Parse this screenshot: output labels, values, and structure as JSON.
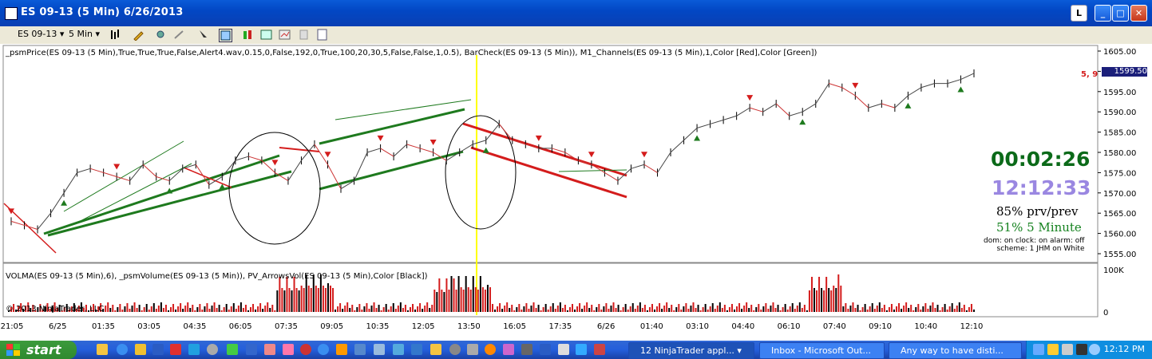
{
  "window": {
    "title": "ES 09-13 (5 Min)  6/26/2013",
    "buttons": [
      "L",
      "_",
      "□",
      "✕"
    ]
  },
  "toolbar": {
    "instrument": "ES 09-13",
    "interval": "5 Min"
  },
  "chart": {
    "indicator_label": "_psmPrice(ES 09-13 (5 Min),True,True,True,False,Alert4.wav,0.15,0,False,192,0,True,100,20,30,5,False,False,1,0.5), BarCheck(ES 09-13 (5 Min)), M1_Channels(ES 09-13 (5 Min),1,Color [Red],Color [Green])",
    "volume_label": "VOLMA(ES 09-13 (5 Min),6), _psmVolume(ES 09-13 (5 Min)), PV_ArrowsVol(ES 09-13 (5 Min),Color [Black])",
    "copyright": "© 2013 NinjaTrader, LLC",
    "price_axis": [
      "1605.00",
      "1600.00",
      "1595.00",
      "1590.00",
      "1585.00",
      "1580.00",
      "1575.00",
      "1570.00",
      "1565.00",
      "1560.00",
      "1555.00"
    ],
    "volume_axis": [
      "100K",
      "0"
    ],
    "last_price": "1599.50",
    "side_marker": "5, 9",
    "time_axis": [
      "21:05",
      "6/25",
      "01:35",
      "03:05",
      "04:35",
      "06:05",
      "07:35",
      "09:05",
      "10:35",
      "12:05",
      "13:50",
      "16:05",
      "17:35",
      "6/26",
      "01:40",
      "03:10",
      "04:40",
      "06:10",
      "07:40",
      "09:10",
      "10:40",
      "12:10"
    ],
    "bar_timer": "00:02:26",
    "clock_time": "12:12:33",
    "stat_prev": "85% prv/prev",
    "stat_interval": "51% 5 Minute",
    "status_line1": "dom: on clock: on alarm: off",
    "status_line2": "scheme: 1 JHM on White",
    "colors": {
      "up_channel": "#1e7a1e",
      "down_channel": "#d41c1c",
      "highlight": "#ffff00",
      "timer": "#0b6a19",
      "clock": "#9a87e1"
    }
  },
  "chart_data": {
    "type": "line",
    "ylim": [
      1555,
      1605
    ],
    "series": [
      {
        "values": [
          1563,
          1562,
          1561,
          1565,
          1570,
          1575,
          1576,
          1575,
          1574,
          1573,
          1577,
          1574,
          1573,
          1576,
          1577,
          1572,
          1574,
          1578,
          1579,
          1578,
          1575,
          1573,
          1578,
          1582,
          1577,
          1571,
          1573,
          1580,
          1581,
          1579,
          1582,
          1581,
          1580,
          1578,
          1580,
          1582,
          1583,
          1587,
          1583,
          1582,
          1581,
          1581,
          1580,
          1578,
          1577,
          1575,
          1573,
          1576,
          1577,
          1575,
          1580,
          1583,
          1586,
          1587,
          1588,
          1589,
          1591,
          1590,
          1592,
          1589,
          1590,
          1592,
          1597,
          1596,
          1594,
          1591,
          1592,
          1591,
          1594,
          1596,
          1597,
          1597,
          1598,
          1599.5
        ]
      }
    ]
  },
  "taskbar": {
    "start_label": "start",
    "tasks": [
      "12 NinjaTrader appl...",
      "Inbox - Microsoft Out...",
      "Any way to have disti..."
    ],
    "time": "12:12 PM"
  }
}
